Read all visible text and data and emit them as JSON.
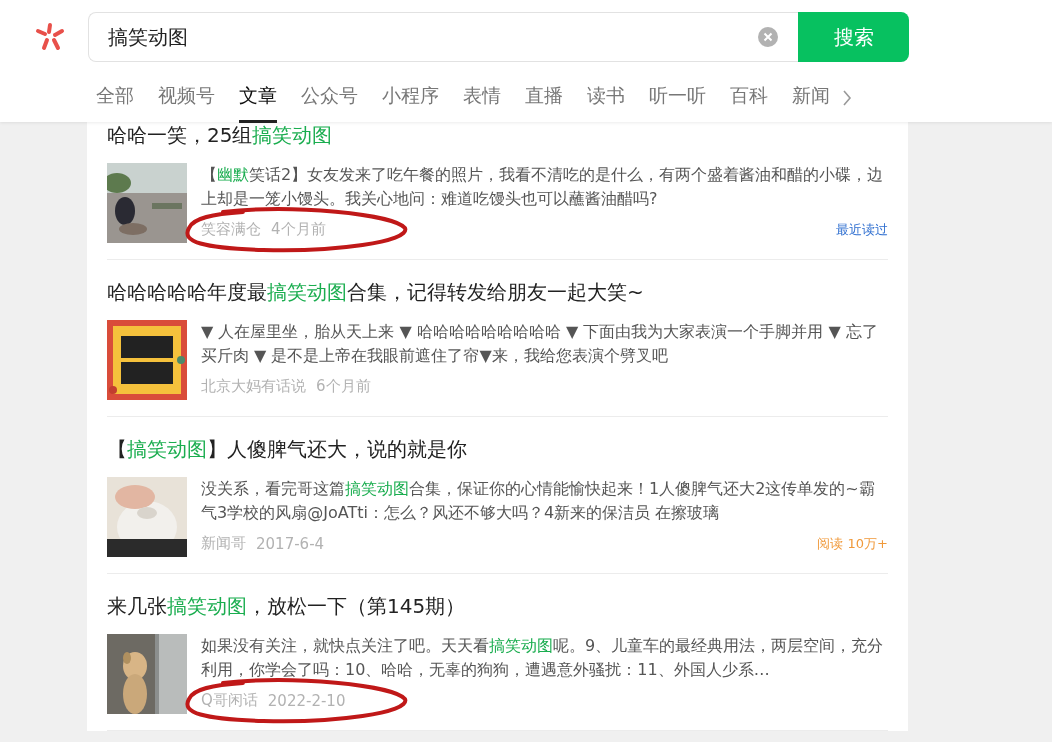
{
  "search": {
    "value": "搞笑动图",
    "button": "搜索"
  },
  "tabs": [
    {
      "label": "全部",
      "selected": false
    },
    {
      "label": "视频号",
      "selected": false
    },
    {
      "label": "文章",
      "selected": true
    },
    {
      "label": "公众号",
      "selected": false
    },
    {
      "label": "小程序",
      "selected": false
    },
    {
      "label": "表情",
      "selected": false
    },
    {
      "label": "直播",
      "selected": false
    },
    {
      "label": "读书",
      "selected": false
    },
    {
      "label": "听一听",
      "selected": false
    },
    {
      "label": "百科",
      "selected": false
    },
    {
      "label": "新闻",
      "selected": false
    }
  ],
  "articles": [
    {
      "title": [
        {
          "text": "哈哈一笑，25组",
          "highlight": false
        },
        {
          "text": "搞笑动图",
          "highlight": true
        }
      ],
      "thumb": {
        "kind": "picture"
      },
      "snippet": [
        {
          "text": "【",
          "highlight": false
        },
        {
          "text": "幽默",
          "highlight": true
        },
        {
          "text": "笑话2】女友发来了吃午餐的照片，我看不清吃的是什么，有两个盛着酱油和醋的小碟，边上却是一笼小馒头。我关心地问：难道吃馒头也可以蘸酱油醋吗?",
          "highlight": false
        }
      ],
      "author": "笑容满仓",
      "time": "4个月前",
      "tag": {
        "kind": "read-before",
        "text": "最近读过"
      },
      "circled": true
    },
    {
      "title": [
        {
          "text": "哈哈哈哈哈年度最",
          "highlight": false
        },
        {
          "text": "搞笑动图",
          "highlight": true
        },
        {
          "text": "合集，记得转发给朋友一起大笑~",
          "highlight": false
        }
      ],
      "thumb": {
        "kind": "picture"
      },
      "snippet": [
        {
          "text": "▼ 人在屋里坐，胎从天上来 ▼ 哈哈哈哈哈哈哈哈哈 ▼ 下面由我为大家表演一个手脚并用 ▼ 忘了买斤肉 ▼ 是不是上帝在我眼前遮住了帘▼来，我给您表演个劈叉吧",
          "highlight": false
        }
      ],
      "author": "北京大妈有话说",
      "time": "6个月前",
      "circled": false
    },
    {
      "title": [
        {
          "text": "【",
          "highlight": false
        },
        {
          "text": "搞笑动图",
          "highlight": true
        },
        {
          "text": "】人傻脾气还大，说的就是你",
          "highlight": false
        }
      ],
      "thumb": {
        "kind": "picture"
      },
      "snippet": [
        {
          "text": "没关系，看完哥这篇",
          "highlight": false
        },
        {
          "text": "搞笑动图",
          "highlight": true
        },
        {
          "text": "合集，保证你的心情能愉快起来！1人傻脾气还大2这传单发的~霸气3学校的风扇@JoATti：怎么？风还不够大吗？4新来的保洁员 在擦玻璃",
          "highlight": false
        }
      ],
      "author": "新闻哥",
      "time": "2017-6-4",
      "tag": {
        "kind": "views",
        "text": "阅读 10万+"
      },
      "circled": false
    },
    {
      "title": [
        {
          "text": "来几张",
          "highlight": false
        },
        {
          "text": "搞笑动图",
          "highlight": true
        },
        {
          "text": "，放松一下（第145期）",
          "highlight": false
        }
      ],
      "thumb": {
        "kind": "picture"
      },
      "snippet": [
        {
          "text": "如果没有关注，就快点关注了吧。天天看",
          "highlight": false
        },
        {
          "text": "搞笑动图",
          "highlight": true
        },
        {
          "text": "呢。9、儿童车的最经典用法，两层空间，充分利用，你学会了吗：10、哈哈，无辜的狗狗，遭遇意外骚扰：11、外国人少系…",
          "highlight": false
        }
      ],
      "author": "Q哥闲话",
      "time": "2022-2-10",
      "circled": true
    }
  ]
}
